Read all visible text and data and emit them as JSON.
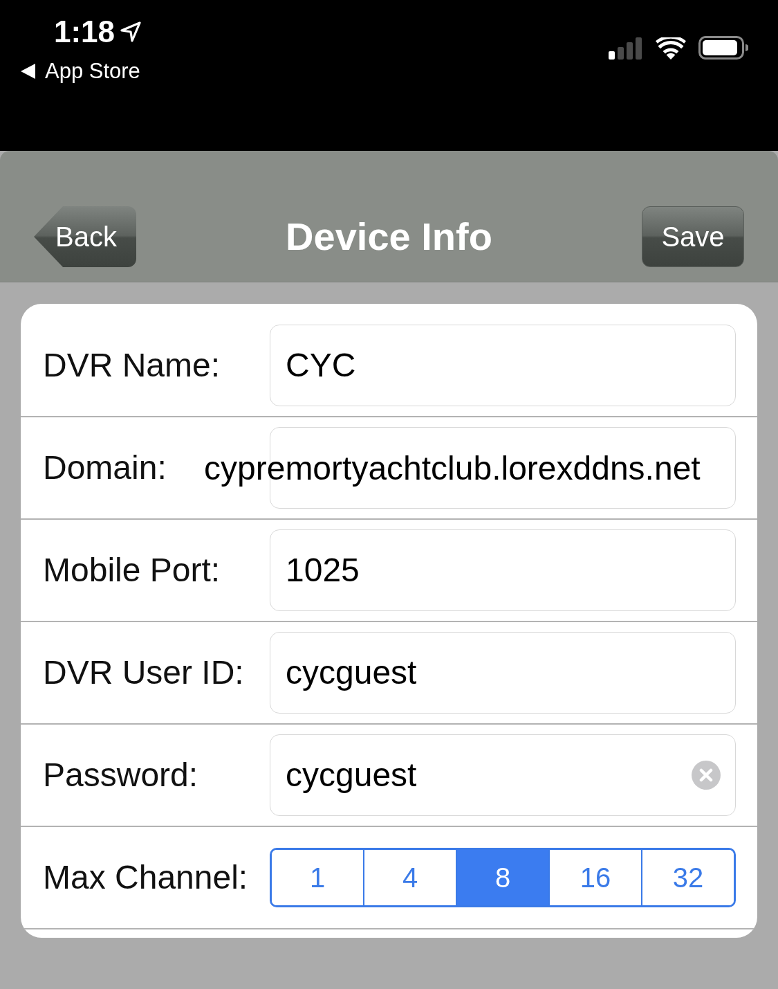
{
  "status_bar": {
    "time": "1:18",
    "back_link": "App Store"
  },
  "nav_bar": {
    "back_button": "Back",
    "title": "Device Info",
    "save_button": "Save"
  },
  "form": {
    "rows": [
      {
        "kind": "text",
        "label": "DVR Name:",
        "value": "CYC",
        "clear_button": false
      },
      {
        "kind": "overflow",
        "label": "Domain:",
        "value": "cypremortyachtclub.lorexddns.net",
        "clear_button": false
      },
      {
        "kind": "text",
        "label": "Mobile Port:",
        "value": "1025",
        "clear_button": false
      },
      {
        "kind": "text",
        "label": "DVR User ID:",
        "value": "cycguest",
        "clear_button": false
      },
      {
        "kind": "text",
        "label": "Password:",
        "value": "cycguest",
        "clear_button": true
      },
      {
        "kind": "segmented",
        "label": "Max Channel:",
        "options": [
          {
            "label": "1",
            "selected": false
          },
          {
            "label": "4",
            "selected": false
          },
          {
            "label": "8",
            "selected": true
          },
          {
            "label": "16",
            "selected": false
          },
          {
            "label": "32",
            "selected": false
          }
        ]
      }
    ]
  }
}
